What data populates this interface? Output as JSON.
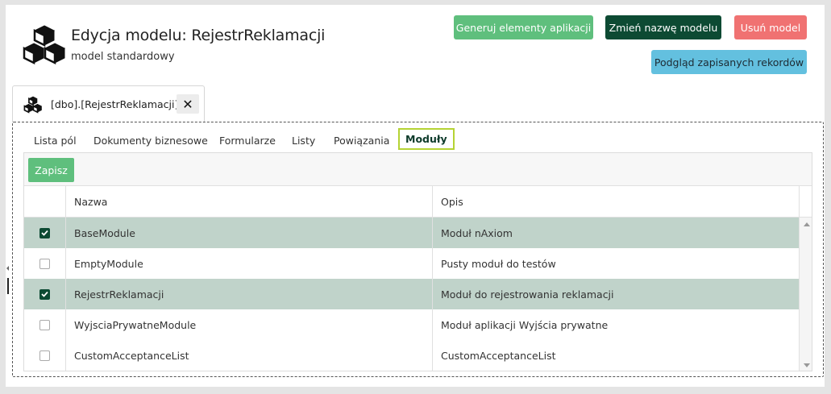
{
  "header": {
    "title": "Edycja modelu: RejestrReklamacji",
    "subtitle": "model standardowy",
    "icon": "cubes-icon"
  },
  "actions": {
    "generate_label": "Generuj elementy aplikacji",
    "rename_label": "Zmień nazwę modelu",
    "delete_label": "Usuń model",
    "preview_label": "Podgląd zapisanych rekordów"
  },
  "document_tab": {
    "label": "[dbo].[RejestrReklamacji]",
    "close_glyph": "✕",
    "icon": "cubes-icon"
  },
  "subtabs": [
    {
      "label": "Lista pól"
    },
    {
      "label": "Dokumenty biznesowe"
    },
    {
      "label": "Formularze"
    },
    {
      "label": "Listy"
    },
    {
      "label": "Powiązania"
    },
    {
      "label": "Moduły",
      "active": true
    }
  ],
  "grid": {
    "save_label": "Zapisz",
    "columns": {
      "name": "Nazwa",
      "description": "Opis"
    },
    "rows": [
      {
        "name": "BaseModule",
        "description": "Moduł nAxiom",
        "checked": true
      },
      {
        "name": "EmptyModule",
        "description": "Pusty moduł do testów",
        "checked": false
      },
      {
        "name": "RejestrReklamacji",
        "description": "Moduł do rejestrowania reklamacji",
        "checked": true
      },
      {
        "name": "WyjsciaPrywatneModule",
        "description": "Moduł aplikacji Wyjścia prywatne",
        "checked": false
      },
      {
        "name": "CustomAcceptanceList",
        "description": "CustomAcceptanceList",
        "checked": false
      }
    ]
  },
  "colors": {
    "primary_green": "#5fbf7d",
    "dark_green": "#0d4a33",
    "danger": "#f07272",
    "info": "#63c0df",
    "selected_row": "#c0d3ca",
    "active_tab_border": "#b5d334"
  }
}
